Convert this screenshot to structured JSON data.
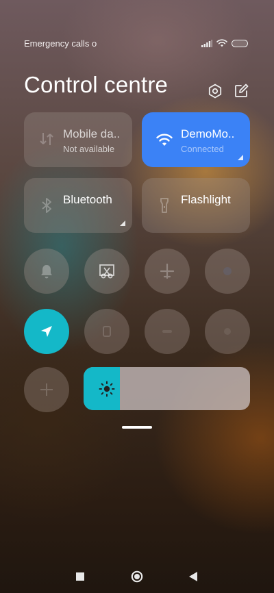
{
  "status": {
    "text": "Emergency calls o"
  },
  "header": {
    "title": "Control centre"
  },
  "tiles": [
    {
      "label": "Mobile da..",
      "sub": "Not available",
      "icon": "mobile-data-icon",
      "active": false
    },
    {
      "label": "DemoMo..",
      "sub": "Connected",
      "icon": "wifi-icon",
      "active": true
    },
    {
      "label": "Bluetooth",
      "sub": "",
      "icon": "bluetooth-icon",
      "active": false
    },
    {
      "label": "Flashlight",
      "sub": "",
      "icon": "flashlight-icon",
      "active": false
    }
  ],
  "toggles": [
    {
      "icon": "bell-icon",
      "on": false
    },
    {
      "icon": "screenshot-icon",
      "on": false
    },
    {
      "icon": "airplane-icon",
      "on": false
    },
    {
      "icon": "unknown-icon",
      "on": false
    },
    {
      "icon": "location-icon",
      "on": true
    },
    {
      "icon": "unknown-icon",
      "on": false
    },
    {
      "icon": "unknown-icon",
      "on": false
    },
    {
      "icon": "unknown-icon",
      "on": false
    },
    {
      "icon": "auto-rotate-icon",
      "on": false
    }
  ],
  "brightness": {
    "level_fraction": 0.22
  },
  "colors": {
    "accent_blue": "#3b82f6",
    "accent_teal": "#14b8c8"
  }
}
